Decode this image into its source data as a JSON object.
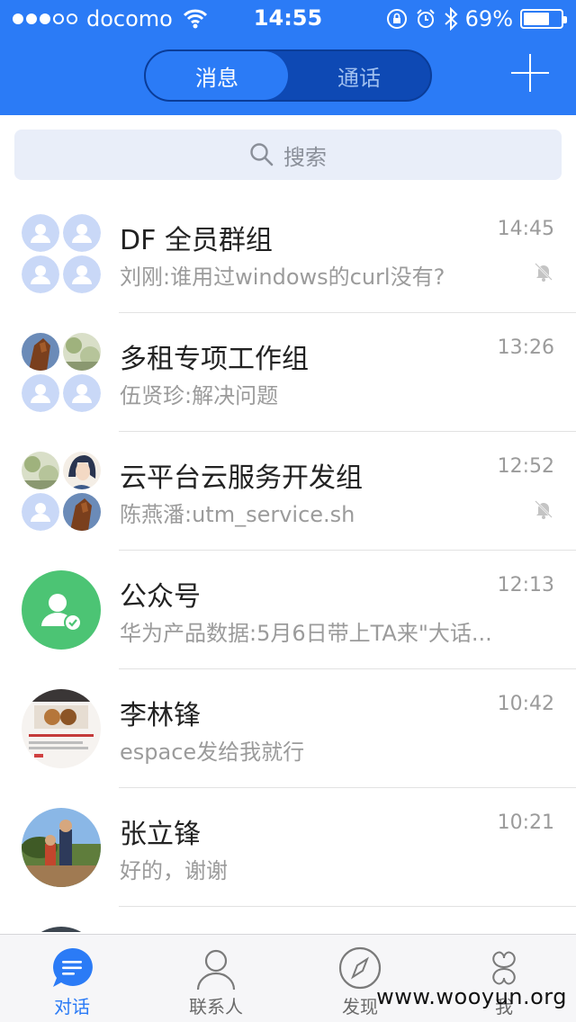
{
  "status_bar": {
    "carrier": "docomo",
    "time": "14:55",
    "battery": "69%",
    "battery_level": 0.69,
    "signal_bars_filled": 3,
    "signal_bars_total": 5
  },
  "nav": {
    "segments": [
      "消息",
      "通话"
    ],
    "active_segment": 0,
    "add_icon": "plus-icon"
  },
  "search": {
    "placeholder": "搜索"
  },
  "conversations": [
    {
      "name": "DF 全员群组",
      "time": "14:45",
      "preview": "刘刚:谁用过windows的curl没有?",
      "muted": true
    },
    {
      "name": "多租专项工作组",
      "time": "13:26",
      "preview": "伍贤珍:解决问题",
      "muted": false
    },
    {
      "name": "云平台云服务开发组",
      "time": "12:52",
      "preview": "陈燕潘:utm_service.sh",
      "muted": true
    },
    {
      "name": "公众号",
      "time": "12:13",
      "preview": "华为产品数据:5月6日带上TA来\"大话...",
      "muted": false
    },
    {
      "name": "李林锋",
      "time": "10:42",
      "preview": "espace发给我就行",
      "muted": false
    },
    {
      "name": "张立锋",
      "time": "10:21",
      "preview": "好的，谢谢",
      "muted": false
    }
  ],
  "tabs": [
    {
      "label": "对话",
      "icon": "chat-bubble-icon"
    },
    {
      "label": "联系人",
      "icon": "person-icon"
    },
    {
      "label": "发现",
      "icon": "compass-icon"
    },
    {
      "label": "我",
      "icon": "clover-icon"
    }
  ],
  "active_tab": 0,
  "watermark": "www.wooyun.org",
  "colors": {
    "accent": "#2b7bf6",
    "segment_bg": "#0e49b4",
    "search_bg": "#e9eef9",
    "placeholder_avatar": "#c9d8f7",
    "official_account_avatar": "#4cc474",
    "secondary_text": "#9b9b9b"
  }
}
